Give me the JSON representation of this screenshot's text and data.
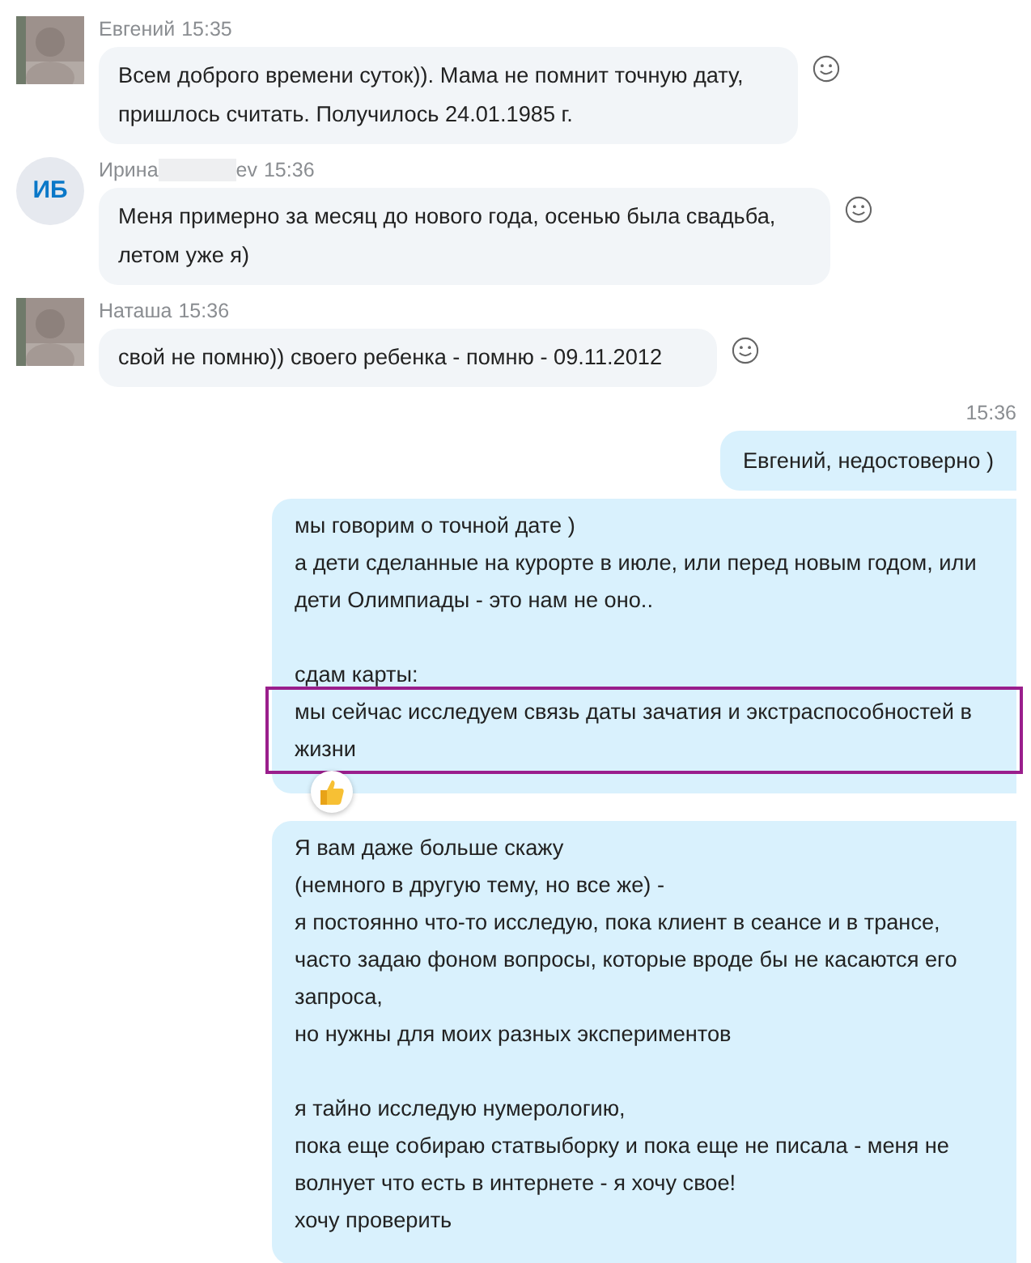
{
  "messages": [
    {
      "kind": "received",
      "sender": "Евгений",
      "redacted": false,
      "time": "15:35",
      "text": "Всем доброго времени суток)). Мама не помнит точную дату,\nпришлось считать. Получилось 24.01.1985 г."
    },
    {
      "kind": "received",
      "avatar": {
        "kind": "initials",
        "initials": "ИБ"
      },
      "sender": "Ирина",
      "redacted": true,
      "sender_tail": "ev",
      "time": "15:36",
      "text": "Меня примерно за месяц до нового года, осенью была свадьба,\nлетом уже я)"
    },
    {
      "kind": "received",
      "sender": "Наташа",
      "redacted": false,
      "time": "15:36",
      "text": "свой не помню)) своего ребенка - помню - 09.11.2012"
    },
    {
      "kind": "sent",
      "time": "15:36",
      "paragraphs": [
        [
          {
            "text": "Евгений, недостоверно )",
            "highlighted": false
          }
        ]
      ],
      "reacted": false
    },
    {
      "kind": "sent",
      "paragraphs": [
        [
          {
            "text": "мы говорим о точной дате )\nа дети сделанные на курорте в июле, или перед новым годом, или\nдети Олимпиады - это нам не оно..",
            "highlighted": false
          }
        ],
        [
          {
            "text": "сдам карты:",
            "highlighted": false
          },
          {
            "text": "мы сейчас исследуем связь даты зачатия и экстраспособностей в\nжизни",
            "highlighted": true
          }
        ]
      ],
      "reacted": true
    },
    {
      "kind": "sent",
      "paragraphs": [
        [
          {
            "text": "Я вам даже больше скажу\n(немного в другую тему, но все же) -\nя постоянно что-то исследую, пока клиент в сеансе и в трансе,\nчасто задаю фоном вопросы, которые вроде бы не касаются его\nзапроса,\nно нужны для моих разных экспериментов",
            "highlighted": false
          }
        ],
        [
          {
            "text": "я тайно исследую нумерологию,\nпока еще собираю статвыборку и пока еще не писала - меня не\nволнует что есть в интернете - я хочу свое!\nхочу проверить",
            "highlighted": false
          }
        ]
      ],
      "reacted": false
    }
  ]
}
